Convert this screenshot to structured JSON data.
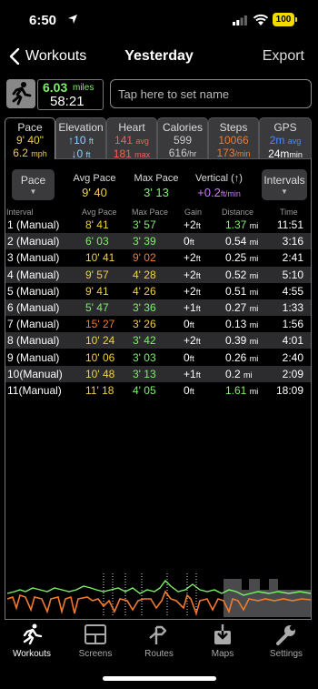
{
  "status": {
    "time": "6:50",
    "battery": "100"
  },
  "nav": {
    "back_label": "Workouts",
    "title": "Yesterday",
    "export_label": "Export"
  },
  "summary": {
    "distance": "6.03",
    "distance_unit": "miles",
    "duration": "58:21",
    "name_placeholder": "Tap here to set name"
  },
  "tabs": [
    {
      "title": "Pace",
      "line1": "9' 40\"",
      "line2": "6.2",
      "line2_unit": "mph"
    },
    {
      "title": "Elevation",
      "line1": "↑10",
      "line1_unit": "ft",
      "line2": "↓0",
      "line2_unit": "ft"
    },
    {
      "title": "Heart",
      "line1": "141",
      "line1_unit": "avg",
      "line2": "181",
      "line2_unit": "max"
    },
    {
      "title": "Calories",
      "line1": "599",
      "line2": "616",
      "line2_unit": "/hr"
    },
    {
      "title": "Steps",
      "line1": "10066",
      "line2": "173",
      "line2_unit": "/min"
    },
    {
      "title": "GPS",
      "line1": "2m",
      "line1_unit": "avg",
      "line2": "24m",
      "line2_unit": "min"
    }
  ],
  "controls": {
    "pace_button": "Pace",
    "intervals_button": "Intervals",
    "avg_pace_label": "Avg Pace",
    "avg_pace_value": "9' 40",
    "max_pace_label": "Max Pace",
    "max_pace_value": "3' 13",
    "vertical_label": "Vertical (↑)",
    "vertical_value": "+0.2",
    "vertical_unit": "ft/min"
  },
  "table": {
    "headers": [
      "Interval",
      "Avg Pace",
      "Max Pace",
      "Gain",
      "Distance",
      "Time"
    ],
    "rows": [
      {
        "interval": "1 (Manual)",
        "avg": "8' 41",
        "max": "3' 57",
        "gain": "+2",
        "dist": "1.37",
        "time": "11:51"
      },
      {
        "interval": "2 (Manual)",
        "avg": "6' 03",
        "max": "3' 39",
        "gain": "0",
        "dist": "0.54",
        "time": "3:16"
      },
      {
        "interval": "3 (Manual)",
        "avg": "10' 41",
        "max": "9' 02",
        "gain": "+2",
        "dist": "0.25",
        "time": "2:41"
      },
      {
        "interval": "4 (Manual)",
        "avg": "9' 57",
        "max": "4' 28",
        "gain": "+2",
        "dist": "0.52",
        "time": "5:10"
      },
      {
        "interval": "5 (Manual)",
        "avg": "9' 41",
        "max": "4' 26",
        "gain": "+2",
        "dist": "0.51",
        "time": "4:55"
      },
      {
        "interval": "6 (Manual)",
        "avg": "5' 47",
        "max": "3' 36",
        "gain": "+1",
        "dist": "0.27",
        "time": "1:33"
      },
      {
        "interval": "7 (Manual)",
        "avg": "15' 27",
        "max": "3' 26",
        "gain": "0",
        "dist": "0.13",
        "time": "1:56"
      },
      {
        "interval": "8 (Manual)",
        "avg": "10' 24",
        "max": "3' 42",
        "gain": "+2",
        "dist": "0.39",
        "time": "4:01"
      },
      {
        "interval": "9 (Manual)",
        "avg": "10' 06",
        "max": "3' 03",
        "gain": "0",
        "dist": "0.26",
        "time": "2:40"
      },
      {
        "interval": "10(Manual)",
        "avg": "10' 48",
        "max": "3' 13",
        "gain": "+1",
        "dist": "0.2",
        "time": "2:09"
      },
      {
        "interval": "11(Manual)",
        "avg": "11' 18",
        "max": "4' 05",
        "gain": "0",
        "dist": "1.61",
        "time": "18:09"
      }
    ],
    "gain_unit": "ft",
    "dist_unit": "mi"
  },
  "tabbar": [
    {
      "label": "Workouts",
      "icon": "runner-icon"
    },
    {
      "label": "Screens",
      "icon": "screens-icon"
    },
    {
      "label": "Routes",
      "icon": "routes-icon"
    },
    {
      "label": "Maps",
      "icon": "maps-download-icon"
    },
    {
      "label": "Settings",
      "icon": "wrench-icon"
    }
  ],
  "colors": {
    "accent_green": "#7ef06a",
    "pace_yellow": "#f3d03f",
    "pace_orange": "#f07b2e",
    "heart_red": "#ff5a5a"
  }
}
